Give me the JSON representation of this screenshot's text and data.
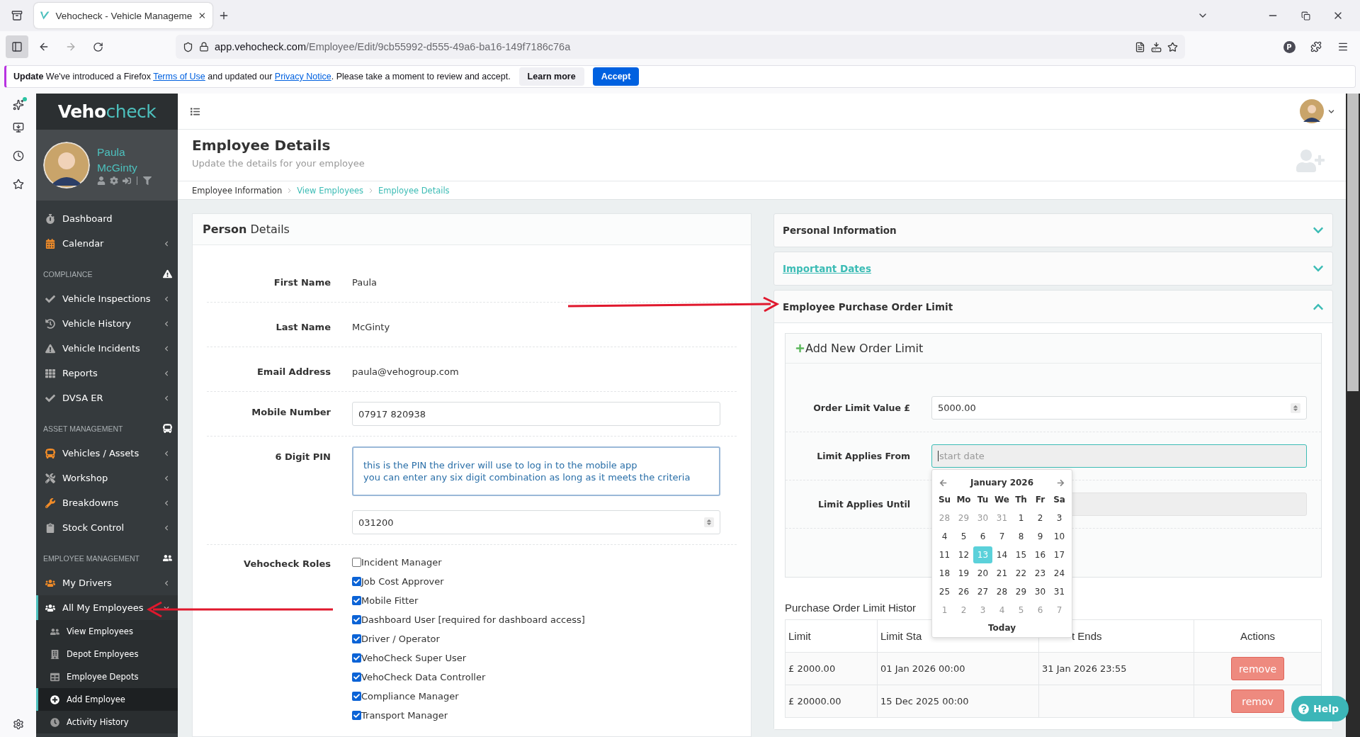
{
  "browser": {
    "tab_title": "Vehocheck - Vehicle Manageme",
    "url_host": "app.vehocheck.com",
    "url_path": "/Employee/Edit/9cb55992-d555-49a6-ba16-149f7186c76a",
    "profile_initial": "P"
  },
  "notice": {
    "parts": [
      {
        "kind": "bold",
        "text": "Update"
      },
      {
        "kind": "text",
        "text": " We've introduced a Firefox "
      },
      {
        "kind": "link",
        "text": "Terms of Use"
      },
      {
        "kind": "text",
        "text": " and updated our "
      },
      {
        "kind": "link",
        "text": "Privacy Notice"
      },
      {
        "kind": "text",
        "text": ". Please take a moment to review and accept."
      }
    ],
    "buttons": [
      {
        "label": "Learn more",
        "kind": "secondary"
      },
      {
        "label": "Accept",
        "kind": "primary"
      }
    ]
  },
  "sidebar": {
    "logo": {
      "part_1": "Veho",
      "part_2": "check"
    },
    "user": {
      "first_name": "Paula",
      "last_name": "McGinty"
    },
    "groups": [
      {
        "items": [
          {
            "label": "Dashboard",
            "kind": "link"
          },
          {
            "label": "Calendar",
            "kind": "menu",
            "expanded": false
          }
        ]
      },
      {
        "heading": "COMPLIANCE",
        "items": [
          {
            "label": "Vehicle Inspections",
            "kind": "menu",
            "expanded": false
          },
          {
            "label": "Vehicle History",
            "kind": "menu",
            "expanded": false
          },
          {
            "label": "Vehicle Incidents",
            "kind": "menu",
            "expanded": false
          },
          {
            "label": "Reports",
            "kind": "menu",
            "expanded": false
          },
          {
            "label": "DVSA ER",
            "kind": "menu",
            "expanded": false
          }
        ]
      },
      {
        "heading": "ASSET MANAGEMENT",
        "items": [
          {
            "label": "Vehicles / Assets",
            "kind": "menu",
            "expanded": false
          },
          {
            "label": "Workshop",
            "kind": "menu",
            "expanded": false
          },
          {
            "label": "Breakdowns",
            "kind": "menu",
            "expanded": false
          },
          {
            "label": "Stock Control",
            "kind": "menu",
            "expanded": false
          }
        ]
      },
      {
        "heading": "EMPLOYEE MANAGEMENT",
        "items": [
          {
            "label": "My Drivers",
            "kind": "menu",
            "expanded": false
          },
          {
            "label": "All My Employees",
            "kind": "menu",
            "expanded": true,
            "children": [
              {
                "label": "View Employees",
                "selected": false
              },
              {
                "label": "Depot Employees",
                "selected": false
              },
              {
                "label": "Employee Depots",
                "selected": false
              },
              {
                "label": "Add Employee",
                "selected": true
              },
              {
                "label": "Activity History",
                "selected": false
              }
            ]
          }
        ]
      }
    ]
  },
  "page": {
    "title": "Employee Details",
    "subtitle": "Update the details for your employee",
    "breadcrumb": [
      {
        "label": "Employee Information",
        "link": false
      },
      {
        "label": "View Employees",
        "link": true
      },
      {
        "label": "Employee Details",
        "link": true
      }
    ]
  },
  "person": {
    "heading": "**Person** Details",
    "rows": [
      {
        "kind": "static",
        "label": "First Name",
        "value": "Paula"
      },
      {
        "kind": "static",
        "label": "Last Name",
        "value": "McGinty"
      },
      {
        "kind": "static",
        "label": "Email Address",
        "value": "paula@vehogroup.com"
      },
      {
        "kind": "input",
        "label": "Mobile Number",
        "value": "07917 820938"
      },
      {
        "kind": "pin",
        "label": "6 Digit PIN",
        "help": [
          "this is the PIN the driver will use to log in to the mobile app",
          "you can enter any six digit combination as long as it meets the criteria"
        ],
        "value": "031200"
      },
      {
        "kind": "roles",
        "label": "Vehocheck Roles",
        "roles": [
          {
            "label": "Incident Manager",
            "checked": false
          },
          {
            "label": "Job Cost Approver",
            "checked": true
          },
          {
            "label": "Mobile Fitter",
            "checked": true
          },
          {
            "label": "Dashboard User [required for dashboard access]",
            "checked": true
          },
          {
            "label": "Driver / Operator",
            "checked": true
          },
          {
            "label": "VehoCheck Super User",
            "checked": true
          },
          {
            "label": "VehoCheck Data Controller",
            "checked": true
          },
          {
            "label": "Compliance Manager",
            "checked": true
          },
          {
            "label": "Transport Manager",
            "checked": true
          }
        ]
      }
    ]
  },
  "panels": [
    {
      "title": "Personal Information",
      "kind": "plain",
      "expanded": false
    },
    {
      "title": "Important Dates",
      "kind": "link",
      "expanded": false
    },
    {
      "title": "Employee Purchase Order Limit",
      "kind": "plain",
      "expanded": true,
      "form": {
        "title": "Add New Order Limit",
        "fields": [
          {
            "label": "Order Limit Value £",
            "kind": "number",
            "value": "5000.00",
            "focused": false,
            "disabled": false
          },
          {
            "label": "Limit Applies From",
            "kind": "date",
            "placeholder": "start date",
            "focused": true,
            "disabled": false
          },
          {
            "label": "Limit Applies Until",
            "kind": "date",
            "focused": false,
            "disabled": true
          }
        ]
      },
      "history": {
        "title": "Purchase Order Limit Histor",
        "columns": [
          "Limit",
          "Limit Sta",
          "t Ends",
          "Actions"
        ],
        "rows": [
          {
            "limit": "£ 2000.00",
            "start": "01 Jan 2026 00:00",
            "end": "31 Jan 2026 23:55",
            "action": "remove"
          },
          {
            "limit": "£ 20000.00",
            "start": "15 Dec 2025 00:00",
            "action": "remov"
          }
        ]
      }
    }
  ],
  "calendar": {
    "month": "January 2026",
    "weekdays": [
      "Su",
      "Mo",
      "Tu",
      "We",
      "Th",
      "Fr",
      "Sa"
    ],
    "today_label": "Today",
    "days": [
      {
        "label": "28",
        "muted": true,
        "selected": false
      },
      {
        "label": "29",
        "muted": true,
        "selected": false
      },
      {
        "label": "30",
        "muted": true,
        "selected": false
      },
      {
        "label": "31",
        "muted": true,
        "selected": false
      },
      {
        "label": "1",
        "muted": false,
        "selected": false
      },
      {
        "label": "2",
        "muted": false,
        "selected": false
      },
      {
        "label": "3",
        "muted": false,
        "selected": false
      },
      {
        "label": "4",
        "muted": false,
        "selected": false
      },
      {
        "label": "5",
        "muted": false,
        "selected": false
      },
      {
        "label": "6",
        "muted": false,
        "selected": false
      },
      {
        "label": "7",
        "muted": false,
        "selected": false
      },
      {
        "label": "8",
        "muted": false,
        "selected": false
      },
      {
        "label": "9",
        "muted": false,
        "selected": false
      },
      {
        "label": "10",
        "muted": false,
        "selected": false
      },
      {
        "label": "11",
        "muted": false,
        "selected": false
      },
      {
        "label": "12",
        "muted": false,
        "selected": false
      },
      {
        "label": "13",
        "muted": false,
        "selected": true
      },
      {
        "label": "14",
        "muted": false,
        "selected": false
      },
      {
        "label": "15",
        "muted": false,
        "selected": false
      },
      {
        "label": "16",
        "muted": false,
        "selected": false
      },
      {
        "label": "17",
        "muted": false,
        "selected": false
      },
      {
        "label": "18",
        "muted": false,
        "selected": false
      },
      {
        "label": "19",
        "muted": false,
        "selected": false
      },
      {
        "label": "20",
        "muted": false,
        "selected": false
      },
      {
        "label": "21",
        "muted": false,
        "selected": false
      },
      {
        "label": "22",
        "muted": false,
        "selected": false
      },
      {
        "label": "23",
        "muted": false,
        "selected": false
      },
      {
        "label": "24",
        "muted": false,
        "selected": false
      },
      {
        "label": "25",
        "muted": false,
        "selected": false
      },
      {
        "label": "26",
        "muted": false,
        "selected": false
      },
      {
        "label": "27",
        "muted": false,
        "selected": false
      },
      {
        "label": "28",
        "muted": false,
        "selected": false
      },
      {
        "label": "29",
        "muted": false,
        "selected": false
      },
      {
        "label": "30",
        "muted": false,
        "selected": false
      },
      {
        "label": "31",
        "muted": false,
        "selected": false
      },
      {
        "label": "1",
        "muted": true,
        "selected": false
      },
      {
        "label": "2",
        "muted": true,
        "selected": false
      },
      {
        "label": "3",
        "muted": true,
        "selected": false
      },
      {
        "label": "4",
        "muted": true,
        "selected": false
      },
      {
        "label": "5",
        "muted": true,
        "selected": false
      },
      {
        "label": "6",
        "muted": true,
        "selected": false
      },
      {
        "label": "7",
        "muted": true,
        "selected": false
      }
    ]
  },
  "help_button": {
    "label": "Help"
  }
}
